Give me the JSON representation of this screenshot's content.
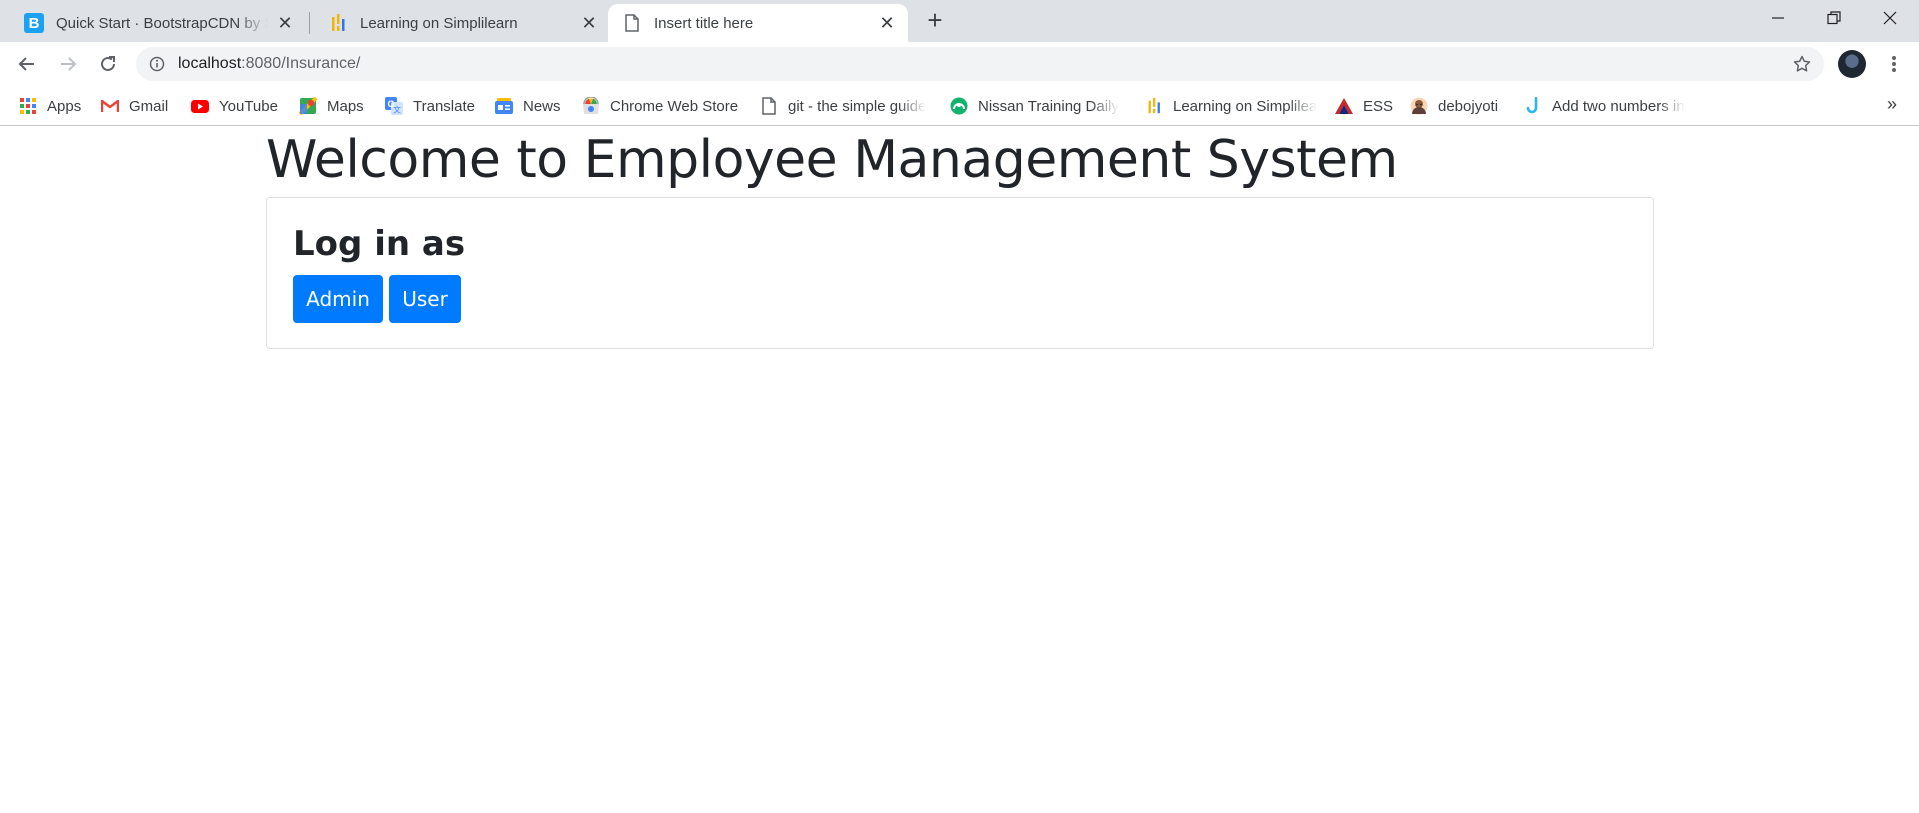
{
  "browser": {
    "tabs": [
      {
        "title": "Quick Start · BootstrapCDN by StackPath",
        "favicon": "bootstrap-b-icon",
        "active": false
      },
      {
        "title": "Learning on Simplilearn",
        "favicon": "simplilearn-icon",
        "active": false
      },
      {
        "title": "Insert title here",
        "favicon": "page-icon",
        "active": true
      }
    ],
    "new_tab_label": "+",
    "address": {
      "host": "localhost",
      "path": ":8080/Insurance/"
    },
    "bookmarks": [
      {
        "label": "Apps",
        "icon": "apps-grid-icon"
      },
      {
        "label": "Gmail",
        "icon": "gmail-icon"
      },
      {
        "label": "YouTube",
        "icon": "youtube-icon"
      },
      {
        "label": "Maps",
        "icon": "maps-icon"
      },
      {
        "label": "Translate",
        "icon": "translate-icon"
      },
      {
        "label": "News",
        "icon": "news-icon"
      },
      {
        "label": "Chrome Web Store",
        "icon": "web-store-icon"
      },
      {
        "label": "git - the simple guide",
        "icon": "page-icon"
      },
      {
        "label": "Nissan Training Daily",
        "icon": "nissan-icon"
      },
      {
        "label": "Learning on Simplilearn",
        "icon": "simplilearn-icon"
      },
      {
        "label": "ESS",
        "icon": "ess-icon"
      },
      {
        "label": "debojyoti",
        "icon": "avatar-icon"
      },
      {
        "label": "Add two numbers in",
        "icon": "hook-icon"
      }
    ],
    "bookmarks_overflow": "»"
  },
  "page": {
    "heading": "Welcome to Employee Management System",
    "card": {
      "title": "Log in as",
      "buttons": [
        {
          "label": "Admin"
        },
        {
          "label": "User"
        }
      ]
    }
  },
  "colors": {
    "primary": "#007bff",
    "text": "#212529",
    "tabstrip": "#dee1e6"
  }
}
